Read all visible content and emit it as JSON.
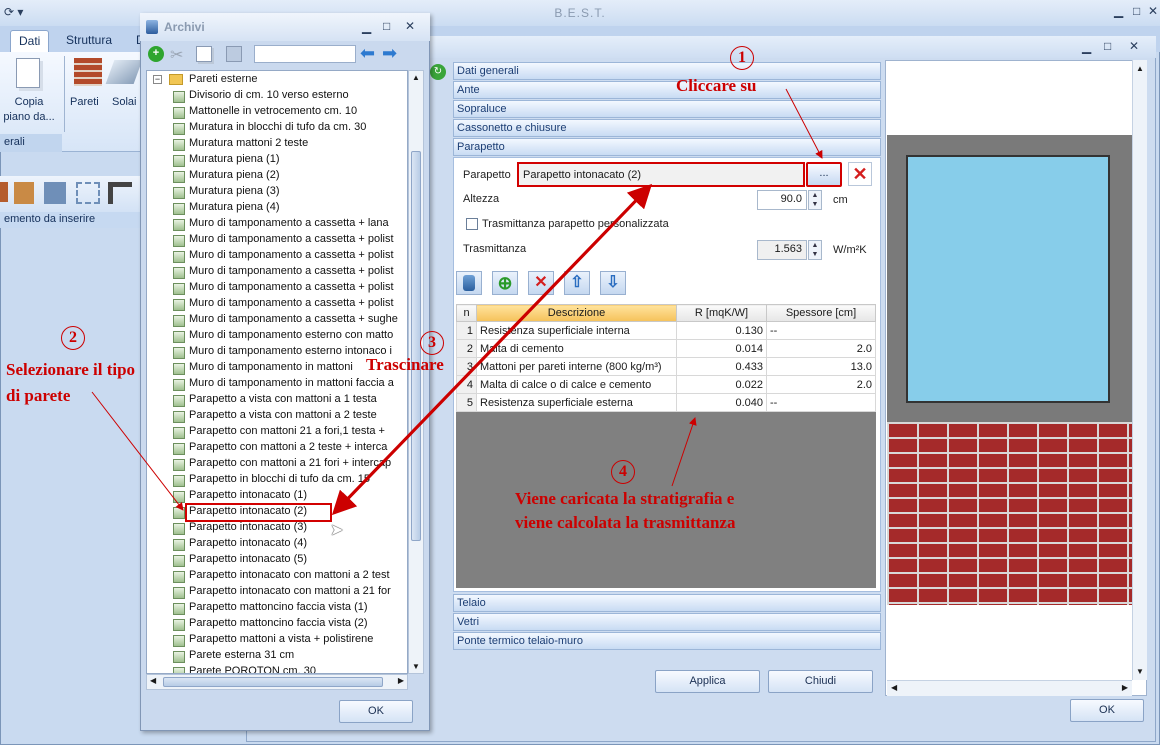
{
  "app": {
    "title": "B.E.S.T."
  },
  "ribbon": {
    "tabs": [
      "Dati",
      "Struttura",
      "D"
    ],
    "btn_copia": "Copia",
    "btn_copia2": "piano da...",
    "btn_pareti": "Pareti",
    "btn_solai": "Solai",
    "group_label": "erali",
    "insert_label": "emento da inserire"
  },
  "archivi": {
    "title": "Archivi",
    "root": "Pareti esterne",
    "items": [
      "Divisorio di cm. 10 verso esterno",
      "Mattonelle in vetrocemento cm. 10",
      "Muratura in blocchi di tufo da cm. 30",
      "Muratura mattoni 2 teste",
      "Muratura piena (1)",
      "Muratura piena (2)",
      "Muratura piena (3)",
      "Muratura piena (4)",
      "Muro di tamponamento a cassetta + lana",
      "Muro di tamponamento a cassetta + polist",
      "Muro di tamponamento a cassetta + polist",
      "Muro di tamponamento a cassetta + polist",
      "Muro di tamponamento a cassetta + polist",
      "Muro di tamponamento a cassetta + polist",
      "Muro di tamponamento a cassetta + sughe",
      "Muro di tamponamento esterno con matto",
      "Muro di tamponamento esterno intonaco i",
      "Muro di tamponamento in mattoni",
      "Muro di tamponamento in mattoni faccia a",
      "Parapetto a vista con mattoni a 1 testa",
      "Parapetto a vista con mattoni a 2 teste",
      "Parapetto con mattoni 21 a fori,1 testa +",
      "Parapetto con mattoni a 2 teste + interca",
      "Parapetto con mattoni a 21 fori + intercap",
      "Parapetto in blocchi di tufo da cm. 15",
      "Parapetto intonacato (1)",
      "Parapetto intonacato (2)",
      "Parapetto intonacato (3)",
      "Parapetto intonacato (4)",
      "Parapetto intonacato (5)",
      "Parapetto intonacato con mattoni a 2 test",
      "Parapetto intonacato con mattoni a 21 for",
      "Parapetto mattoncino faccia vista (1)",
      "Parapetto mattoncino faccia vista (2)",
      "Parapetto mattoni a vista + polistirene",
      "Parete esterna 31 cm",
      "Parete POROTON cm. 30"
    ],
    "ok": "OK"
  },
  "sections_top": [
    "Dati generali",
    "Ante",
    "Sopraluce",
    "Cassonetto e chiusure",
    "Parapetto"
  ],
  "sections_bottom": [
    "Telaio",
    "Vetri",
    "Ponte termico telaio-muro"
  ],
  "parapetto": {
    "label": "Parapetto",
    "value": "Parapetto intonacato (2)",
    "browse": "...",
    "altezza_label": "Altezza",
    "altezza_value": "90.0",
    "altezza_unit": "cm",
    "check_label": "Trasmittanza parapetto personalizzata",
    "trasm_label": "Trasmittanza",
    "trasm_value": "1.563",
    "trasm_unit": "W/m²K"
  },
  "table": {
    "headers": [
      "n",
      "Descrizione",
      "R [mqK/W]",
      "Spessore [cm]"
    ],
    "rows": [
      {
        "n": "1",
        "desc": "Resistenza superficiale interna",
        "r": "0.130",
        "s": "--"
      },
      {
        "n": "2",
        "desc": "Malta di cemento",
        "r": "0.014",
        "s": "2.0"
      },
      {
        "n": "3",
        "desc": "Mattoni per pareti interne (800 kg/m³)",
        "r": "0.433",
        "s": "13.0"
      },
      {
        "n": "4",
        "desc": "Malta di calce o di calce e cemento",
        "r": "0.022",
        "s": "2.0"
      },
      {
        "n": "5",
        "desc": "Resistenza superficiale esterna",
        "r": "0.040",
        "s": "--"
      }
    ]
  },
  "buttons": {
    "applica": "Applica",
    "chiudi": "Chiudi",
    "ok_main": "OK"
  },
  "annotations": {
    "n1": "1",
    "t1": "Cliccare  su",
    "n2": "2",
    "t2a": "Selezionare il tipo",
    "t2b": "di parete",
    "n3": "3",
    "t3": "Trascinare",
    "n4": "4",
    "t4a": "Viene caricata la stratigrafia e",
    "t4b": "viene calcolata la trasmittanza"
  },
  "colors": {
    "annotation": "#cc0000",
    "glass": "#87cdea",
    "brick": "#a52a2a",
    "accent": "#f5c25a"
  }
}
